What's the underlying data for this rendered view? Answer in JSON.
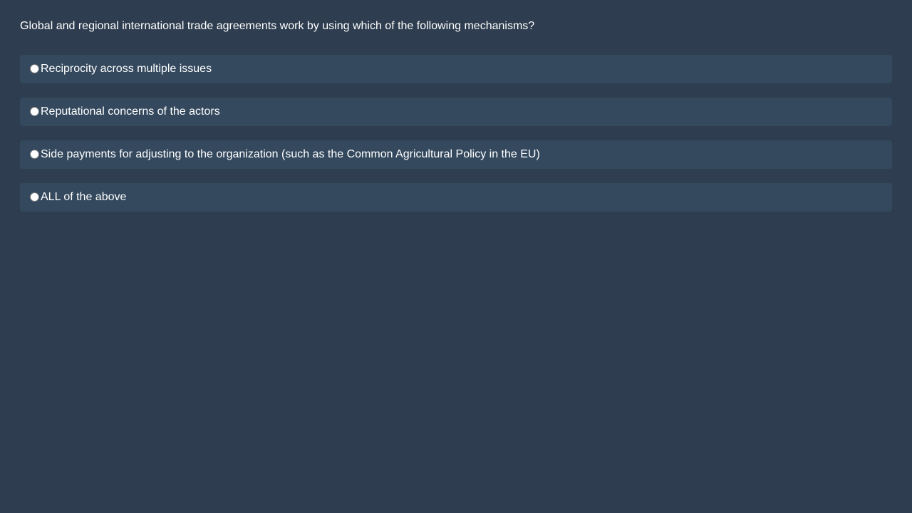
{
  "question": {
    "text": "Global and regional international trade agreements work by using which of the following mechanisms?"
  },
  "options": [
    {
      "label": "Reciprocity across multiple issues"
    },
    {
      "label": "Reputational concerns of the actors"
    },
    {
      "label": "Side payments for adjusting to the organization (such as the Common Agricultural Policy in the EU)"
    },
    {
      "label": "ALL of the above"
    }
  ],
  "colors": {
    "background": "#2e3d4f",
    "option_background": "#34495e",
    "text": "#ffffff"
  }
}
